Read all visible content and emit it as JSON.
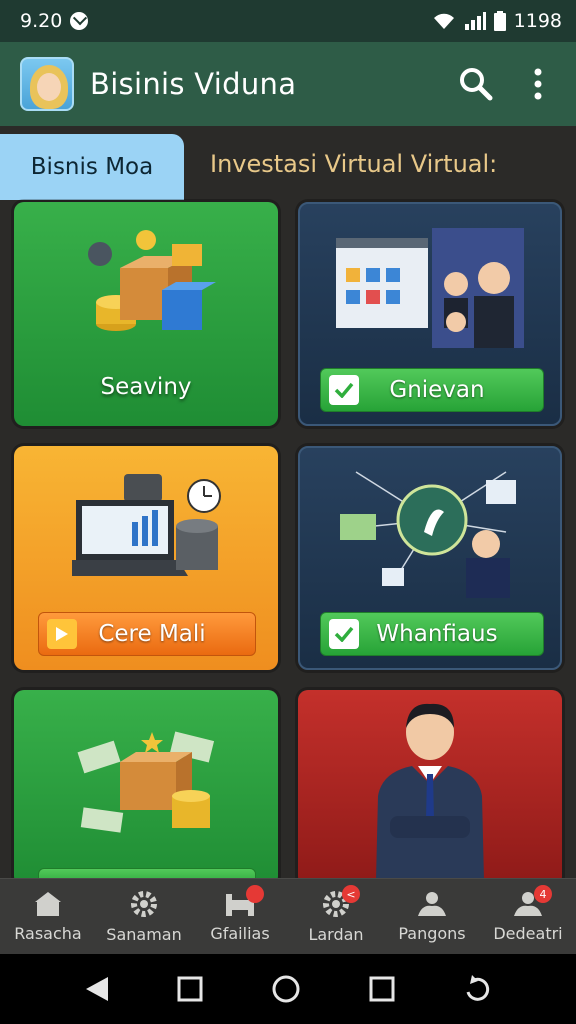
{
  "status_bar": {
    "time": "9.20",
    "battery_text": "1198"
  },
  "app_bar": {
    "title": "Bisinis Viduna",
    "search_icon": "search-icon",
    "menu_icon": "more-vert-icon"
  },
  "header": {
    "tab_label": "Bisnis Moa",
    "section_title": "Investasi Virtual Virtual:"
  },
  "cards": [
    {
      "label": "Seaviny",
      "color": "#2ea743"
    },
    {
      "button_label": "Gnievan",
      "color": "#22384f"
    },
    {
      "button_label": "Cere Mali",
      "color": "#f4a22a"
    },
    {
      "button_label": "Whanfiaus",
      "color": "#22384f"
    },
    {
      "color": "#2ea743"
    },
    {
      "color": "#b02824"
    }
  ],
  "bottom_nav": [
    {
      "label": "Rasacha",
      "icon": "home-icon"
    },
    {
      "label": "Sanaman",
      "icon": "gear-icon"
    },
    {
      "label": "Gfailias",
      "icon": "bed-icon",
      "badge": ""
    },
    {
      "label": "Lardan",
      "icon": "gear-icon",
      "badge": "<"
    },
    {
      "label": "Pangons",
      "icon": "person-icon"
    },
    {
      "label": "Dedeatri",
      "icon": "person-icon",
      "badge": "4"
    }
  ],
  "system_nav": {
    "icons": [
      "back-icon",
      "recents-icon",
      "home-circle-icon",
      "square-icon",
      "rotate-icon"
    ]
  }
}
